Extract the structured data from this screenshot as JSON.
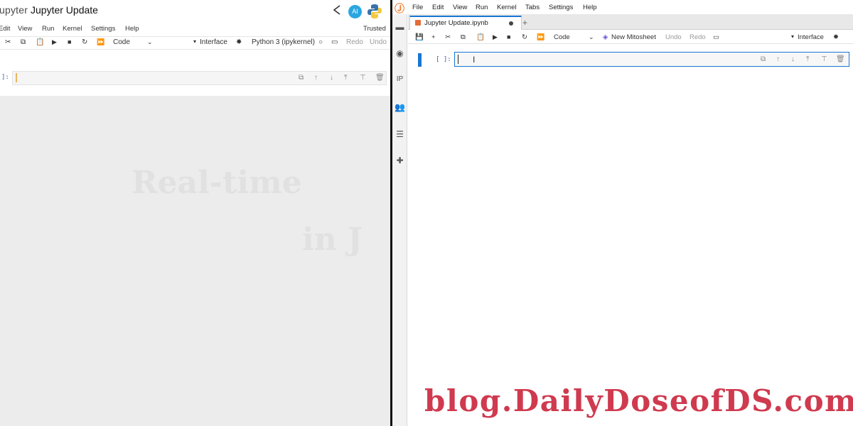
{
  "left_window": {
    "app_logo_text": "upyter",
    "notebook_title": "Jupyter Update",
    "ai_badge": "AI",
    "menu": [
      "Edit",
      "View",
      "Run",
      "Kernel",
      "Settings",
      "Help"
    ],
    "trusted_label": "Trusted",
    "toolbar": {
      "cell_type": "Code",
      "interface_label": "Interface",
      "kernel_name": "Python 3 (ipykernel)",
      "redo_label": "Redo",
      "undo_label": "Undo"
    },
    "cell_prompt": "]:",
    "background_text": [
      "Real-time",
      "in J"
    ]
  },
  "right_window": {
    "menu": [
      "File",
      "Edit",
      "View",
      "Run",
      "Kernel",
      "Tabs",
      "Settings",
      "Help"
    ],
    "sidebar_ip_label": "IP",
    "tab": {
      "label": "Jupyter Update.ipynb",
      "add_label": "+"
    },
    "toolbar": {
      "cell_type": "Code",
      "mitosheet_label": "New Mitosheet",
      "undo_label": "Undo",
      "redo_label": "Redo",
      "interface_label": "Interface"
    },
    "cell_prompt": "[ ]:",
    "watermark": "blog.DailyDoseofDS.com"
  },
  "icons": {
    "cut": "scissors-icon",
    "copy": "copy-icon",
    "paste": "paste-icon",
    "run": "run-icon",
    "stop": "stop-icon",
    "restart": "restart-icon",
    "fast_forward": "run-all-icon",
    "bug": "debugger-icon"
  },
  "colors": {
    "accent_blue": "#1976d2",
    "watermark_red": "#cf3a4f",
    "jupyter_orange": "#f37726",
    "ai_badge_blue": "#2aa7e0"
  }
}
